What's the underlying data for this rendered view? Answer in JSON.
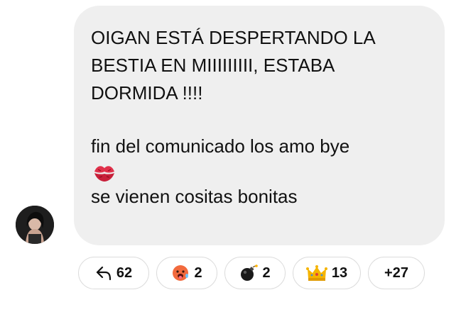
{
  "message": {
    "lines_block1": [
      "OIGAN ESTÁ DESPERTANDO LA",
      "BESTIA EN MIIIIIIIII, ESTABA",
      "DORMIDA !!!!"
    ],
    "line_farewell": "fin del comunicado los amo bye",
    "line_last": "se vienen cositas bonitas"
  },
  "reactions": {
    "reply_count": "62",
    "hot_count": "2",
    "bomb_count": "2",
    "crown_count": "13",
    "more_label": "+27"
  },
  "colors": {
    "bubble": "#efefef",
    "text": "#111111",
    "chip_border": "#dcdcdc"
  },
  "icons": {
    "reply": "reply-arrow-icon",
    "hot": "hot-face-emoji-icon",
    "bomb": "bomb-emoji-icon",
    "crown": "crown-emoji-icon",
    "kiss": "kiss-mark-emoji-icon"
  }
}
